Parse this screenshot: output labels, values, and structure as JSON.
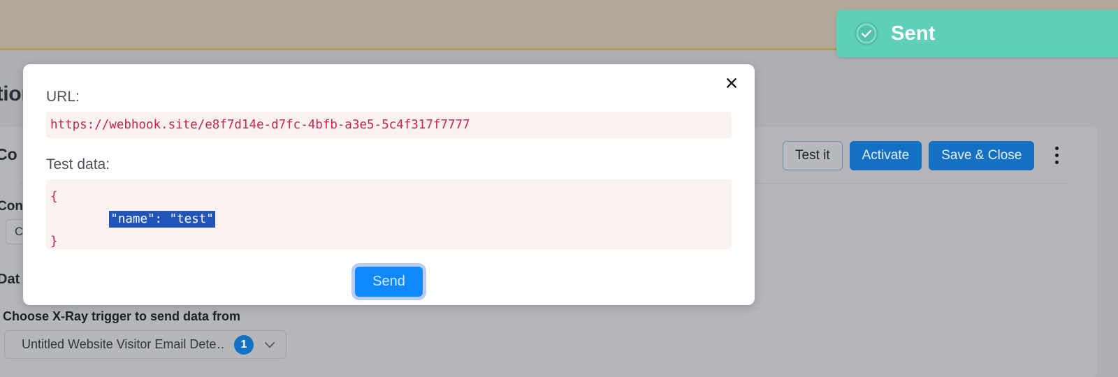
{
  "background": {
    "heading_partial": "ation",
    "section_label_partial": "Co",
    "config_label_partial": "Con",
    "config_input_partial": "Co",
    "data_label_partial": "Dat",
    "xray": {
      "label": "Choose X-Ray trigger to send data from",
      "selected": "Untitled Website Visitor Email Dete…",
      "badge": "1",
      "chevron_icon": "chevron-down-icon"
    },
    "actions": {
      "test_it": "Test it",
      "activate": "Activate",
      "save_close": "Save & Close",
      "more_icon": "kebab-menu-icon"
    },
    "colors": {
      "topbar": "#b3aa9c",
      "topbar_accent": "#b59d4a",
      "page": "#aeb0b4",
      "card": "#b4b6b9",
      "primary": "#1470c2"
    }
  },
  "toast": {
    "message": "Sent",
    "icon": "check-circle-icon",
    "background": "#5fd0b7",
    "text_color": "#ffffff"
  },
  "modal": {
    "close_icon": "close-icon",
    "close_label": "✕",
    "url_label": "URL:",
    "url_value": "https://webhook.site/e8f7d14e-d7fc-4bfb-a3e5-5c4f317f7777",
    "test_data_label": "Test data:",
    "test_data": {
      "line_open": "{",
      "line_selected": "\"name\": \"test\"",
      "line_close": "}",
      "selection_color": "#2255bb"
    },
    "send_label": "Send",
    "send_color": "#1089ff"
  }
}
